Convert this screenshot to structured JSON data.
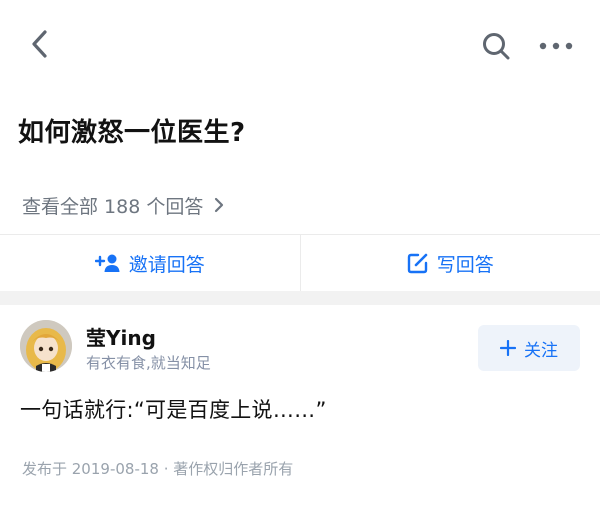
{
  "header": {
    "back_icon": "chevron-left-icon",
    "search_icon": "search-icon",
    "more_icon": "more-horizontal-icon"
  },
  "question": {
    "title": "如何激怒一位医生?",
    "view_all_label": "查看全部 188 个回答",
    "view_all_icon": "chevron-right-icon"
  },
  "actions": {
    "invite_label": "邀请回答",
    "invite_icon": "add-user-icon",
    "write_label": "写回答",
    "write_icon": "edit-icon",
    "accent_color": "#1772f6"
  },
  "answer": {
    "author": {
      "name": "莹Ying",
      "bio": "有衣有食,就当知足",
      "avatar_icon": "avatar-image"
    },
    "follow": {
      "label": "关注",
      "icon": "plus-icon"
    },
    "content": "一句话就行:“可是百度上说……”",
    "meta": "发布于 2019-08-18 · 著作权归作者所有"
  }
}
